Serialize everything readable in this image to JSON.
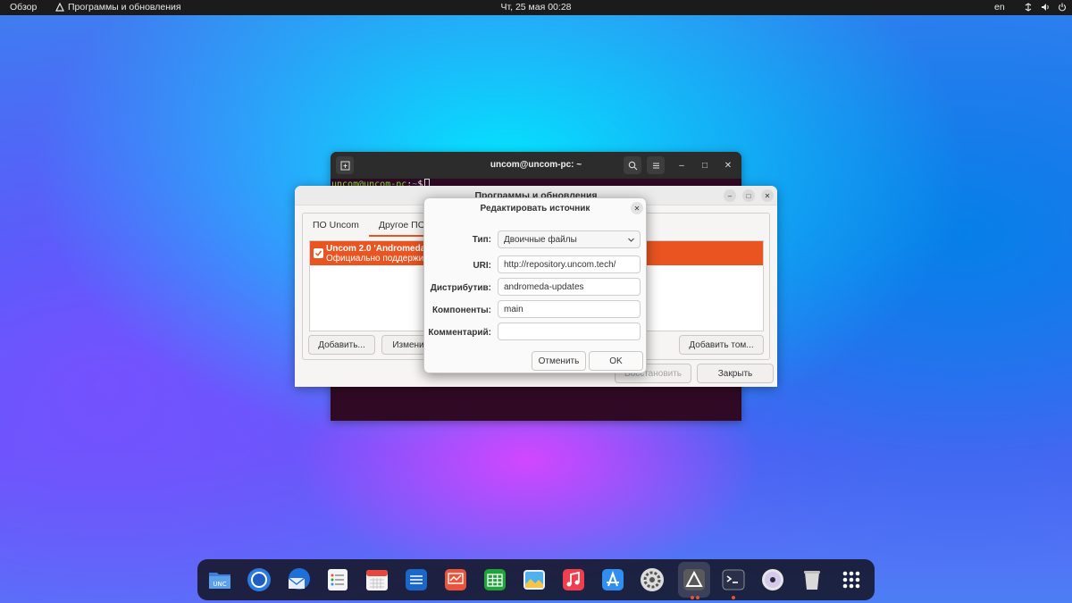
{
  "topbar": {
    "overview": "Обзор",
    "app_name": "Программы и обновления",
    "clock": "Чт, 25 мая  00:28",
    "lang": "en"
  },
  "terminal": {
    "title": "uncom@uncom-pc: ~",
    "prompt_user": "uncom@uncom-pc",
    "prompt_sep": ":",
    "prompt_path": "~",
    "prompt_symbol": "$"
  },
  "software_window": {
    "title": "Программы и обновления",
    "tabs": [
      {
        "label": "ПО Uncom",
        "active": false
      },
      {
        "label": "Другое ПО",
        "active": true
      }
    ],
    "repos": [
      {
        "name": "Uncom 2.0 'Andromeda'",
        "description": "Официально поддержива",
        "checked": true
      }
    ],
    "add_button": "Добавить...",
    "edit_button": "Измени",
    "add_volume_button": "Добавить том...",
    "restore_button": "Восстановить",
    "close_button": "Закрыть"
  },
  "dialog": {
    "title": "Редактировать источник",
    "type_label": "Тип:",
    "type_value": "Двоичные файлы",
    "uri_label": "URI:",
    "uri_value": "http://repository.uncom.tech/",
    "dist_label": "Дистрибутив:",
    "dist_value": "andromeda-updates",
    "components_label": "Компоненты:",
    "components_value": "main",
    "comment_label": "Комментарий:",
    "comment_value": "",
    "cancel_button": "Отменить",
    "ok_button": "OK"
  },
  "dock": {
    "items": [
      {
        "icon": "files-icon",
        "color": "#4a90e2"
      },
      {
        "icon": "browser-icon",
        "color": "#2a7be4"
      },
      {
        "icon": "mail-icon",
        "color": "#1e6fd9"
      },
      {
        "icon": "tasks-icon",
        "color": "#ffffff"
      },
      {
        "icon": "calendar-icon",
        "color": "#e8453c"
      },
      {
        "icon": "document-icon",
        "color": "#1a66c9"
      },
      {
        "icon": "presentation-icon",
        "color": "#e8553c"
      },
      {
        "icon": "spreadsheet-icon",
        "color": "#21a33c"
      },
      {
        "icon": "image-viewer-icon",
        "color": "#3aa2e8"
      },
      {
        "icon": "music-icon",
        "color": "#f03e4e"
      },
      {
        "icon": "app-store-icon",
        "color": "#2f8ef0"
      },
      {
        "icon": "settings-icon",
        "color": "#6e6e6e"
      },
      {
        "icon": "software-updater-icon",
        "color": "#5a5a5a"
      },
      {
        "icon": "terminal-icon",
        "color": "#2c2f4a"
      },
      {
        "icon": "disc-icon",
        "color": "#dcdcdc"
      },
      {
        "icon": "trash-icon",
        "color": "#d9d9d9"
      },
      {
        "icon": "app-grid-icon",
        "color": "#ffffff"
      }
    ]
  },
  "colors": {
    "accent": "#e95420",
    "terminal_bg": "#300a24"
  }
}
